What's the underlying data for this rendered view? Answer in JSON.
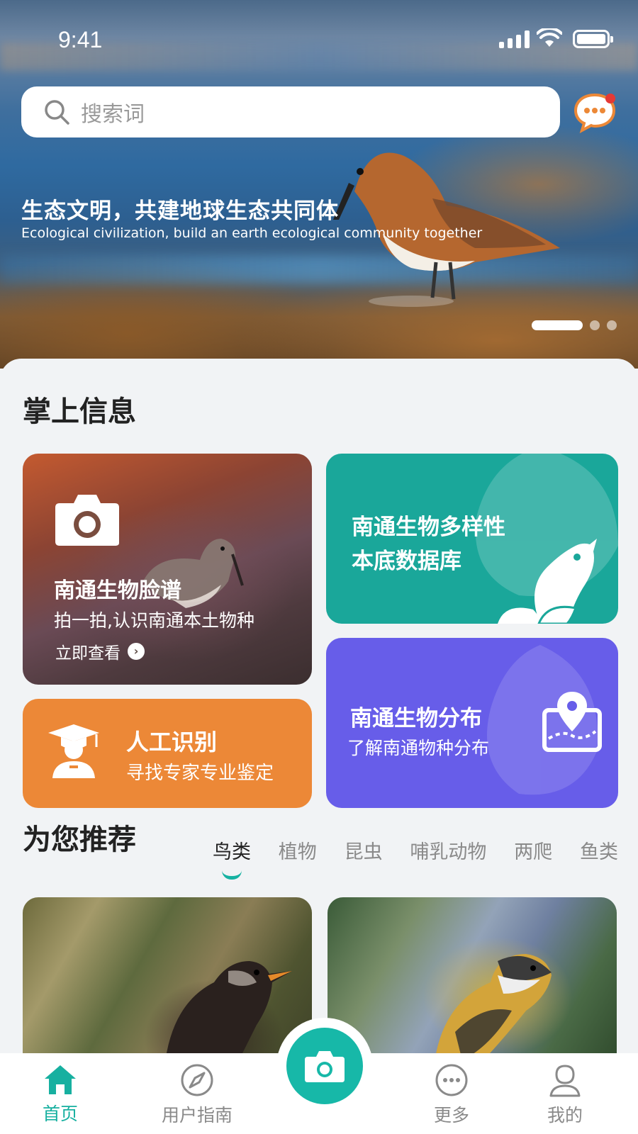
{
  "status_bar": {
    "time": "9:41"
  },
  "search": {
    "placeholder": "搜索词"
  },
  "hero": {
    "title": "生态文明，共建地球生态共同体",
    "subtitle": "Ecological civilization, build an earth ecological community together",
    "pages": 3,
    "active_page": 1
  },
  "section_info": {
    "title": "掌上信息"
  },
  "cards": {
    "face": {
      "title": "南通生物脸谱",
      "desc": "拍一拍,认识南通本土物种",
      "link": "立即查看"
    },
    "database": {
      "line1": "南通生物多样性",
      "line2": "本底数据库"
    },
    "distribution": {
      "title": "南通生物分布",
      "desc": "了解南通物种分布"
    },
    "expert": {
      "title": "人工识别",
      "desc": "寻找专家专业鉴定"
    }
  },
  "recommend": {
    "title": "为您推荐",
    "tabs": [
      "鸟类",
      "植物",
      "昆虫",
      "哺乳动物",
      "两爬",
      "鱼类"
    ],
    "active_tab": "鸟类"
  },
  "bottom_nav": {
    "home": "首页",
    "guide": "用户指南",
    "more": "更多",
    "me": "我的"
  },
  "colors": {
    "accent": "#17b0a0",
    "teal_card": "#1aa79a",
    "purple_card": "#675de9",
    "orange_card": "#ec8837",
    "notification": "#e53935"
  }
}
